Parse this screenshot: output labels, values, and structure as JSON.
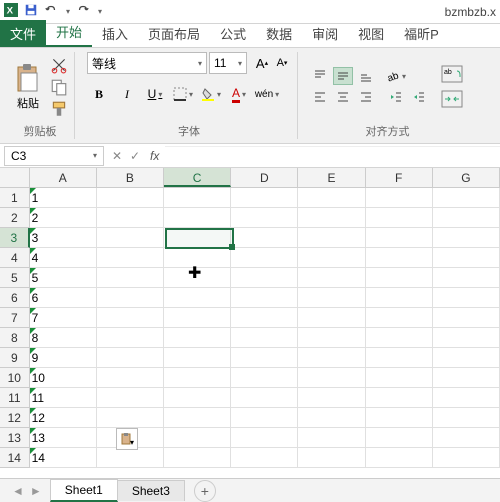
{
  "title_filename": "bzmbzb.x",
  "tabs": {
    "file": "文件",
    "home": "开始",
    "insert": "插入",
    "layout": "页面布局",
    "formula": "公式",
    "data": "数据",
    "review": "审阅",
    "view": "视图",
    "foxit": "福昕P"
  },
  "ribbon": {
    "clipboard": {
      "paste": "粘贴",
      "label": "剪贴板"
    },
    "font": {
      "name": "等线",
      "size": "11",
      "label": "字体",
      "bold": "B",
      "italic": "I",
      "underline": "U",
      "wen": "wén"
    },
    "align": {
      "label": "对齐方式"
    }
  },
  "namebox": "C3",
  "fx": "fx",
  "columns": [
    "A",
    "B",
    "C",
    "D",
    "E",
    "F",
    "G"
  ],
  "row_values": [
    "1",
    "2",
    "3",
    "4",
    "5",
    "6",
    "7",
    "8",
    "9",
    "10",
    "11",
    "12",
    "13",
    "14"
  ],
  "sheets": {
    "s1": "Sheet1",
    "s3": "Sheet3",
    "add": "+"
  },
  "nav": {
    "prev": "◄",
    "next": "►"
  },
  "selected_cell": "C3",
  "chevron": "▾"
}
